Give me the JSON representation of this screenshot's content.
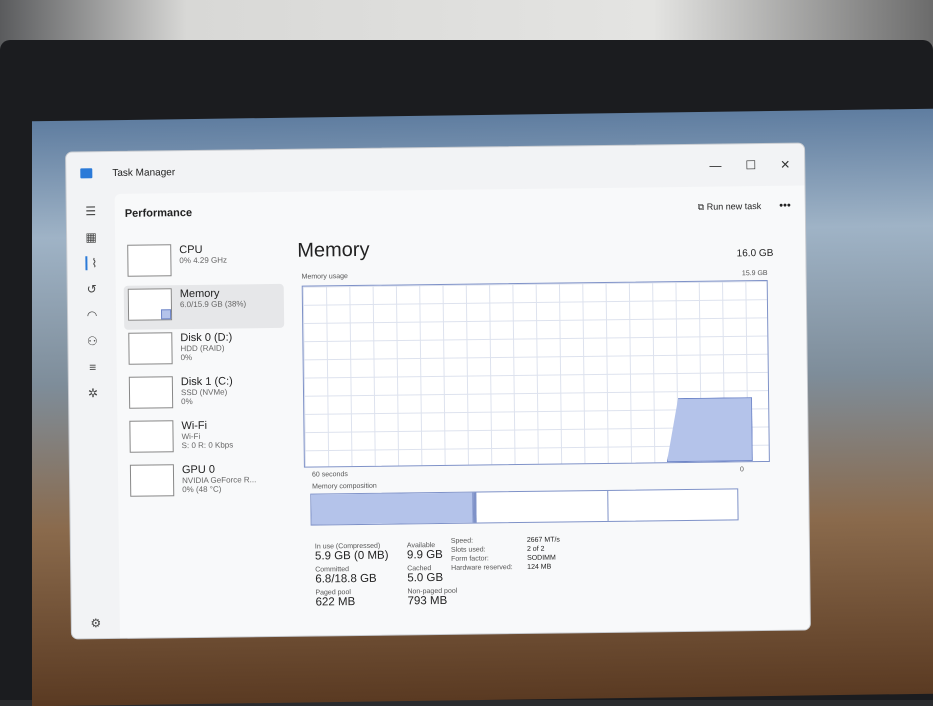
{
  "window": {
    "title": "Task Manager",
    "minimize": "—",
    "maximize": "☐",
    "close": "✕"
  },
  "header": {
    "title": "Performance",
    "run_new_task": "Run new task",
    "more": "•••"
  },
  "sidebar": [
    {
      "name": "CPU",
      "sub1": "0% 4.29 GHz",
      "sub2": ""
    },
    {
      "name": "Memory",
      "sub1": "6.0/15.9 GB (38%)",
      "sub2": ""
    },
    {
      "name": "Disk 0 (D:)",
      "sub1": "HDD (RAID)",
      "sub2": "0%"
    },
    {
      "name": "Disk 1 (C:)",
      "sub1": "SSD (NVMe)",
      "sub2": "0%"
    },
    {
      "name": "Wi-Fi",
      "sub1": "Wi-Fi",
      "sub2": "S: 0 R: 0 Kbps"
    },
    {
      "name": "GPU 0",
      "sub1": "NVIDIA GeForce R...",
      "sub2": "0% (48 °C)"
    }
  ],
  "memory": {
    "title": "Memory",
    "total": "16.0 GB",
    "usage_label": "Memory usage",
    "usage_max": "15.9 GB",
    "time_label": "60 seconds",
    "zero": "0",
    "composition_label": "Memory composition",
    "stats": [
      {
        "label": "In use (Compressed)",
        "value": "5.9 GB (0 MB)"
      },
      {
        "label": "Available",
        "value": "9.9 GB"
      },
      {
        "label": "Committed",
        "value": "6.8/18.8 GB"
      },
      {
        "label": "Cached",
        "value": "5.0 GB"
      },
      {
        "label": "Paged pool",
        "value": "622 MB"
      },
      {
        "label": "Non-paged pool",
        "value": "793 MB"
      }
    ],
    "hardware": [
      {
        "label": "Speed:",
        "value": "2667 MT/s"
      },
      {
        "label": "Slots used:",
        "value": "2 of 2"
      },
      {
        "label": "Form factor:",
        "value": "SODIMM"
      },
      {
        "label": "Hardware reserved:",
        "value": "124 MB"
      }
    ],
    "usage_percent": 38
  }
}
